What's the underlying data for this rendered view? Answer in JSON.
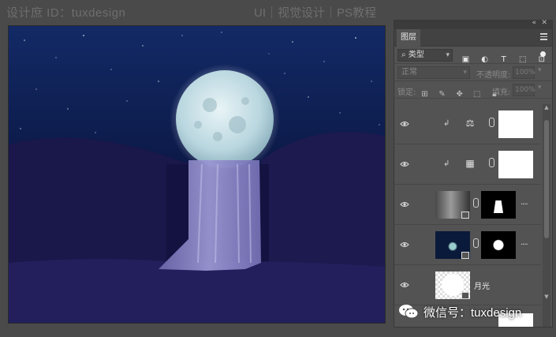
{
  "watermark": {
    "left": "设计庶 ID：tuxdesign",
    "right": "UI｜视觉设计｜PS教程"
  },
  "panel": {
    "collapse_icon": "double-chevron-icon",
    "close_icon": "close-icon",
    "tab_label": "图层",
    "filter_label": "类型",
    "filter_icon": "search-icon",
    "blend_mode": "正常",
    "opacity_label": "不透明度:",
    "opacity_value": "100%",
    "lock_label": "锁定:",
    "fill_label": "填充:",
    "fill_value": "100%"
  },
  "layers": [
    {
      "type": "adjustment",
      "icon": "balance-icon",
      "clipped": true
    },
    {
      "type": "adjustment",
      "icon": "grid-icon",
      "clipped": true
    },
    {
      "type": "image-mask",
      "name": "",
      "has_mask": true
    },
    {
      "type": "image-mask",
      "name": "",
      "has_mask": true
    },
    {
      "type": "smart-object",
      "name": "月光"
    },
    {
      "type": "partial"
    }
  ],
  "wechat": {
    "text": "微信号：tuxdesign"
  },
  "colors": {
    "panel_bg": "#535353",
    "app_bg": "#4a4a4a",
    "sky": "#0a1230",
    "moon": "#cfe4ea",
    "waterfall": "#8a86c8"
  }
}
